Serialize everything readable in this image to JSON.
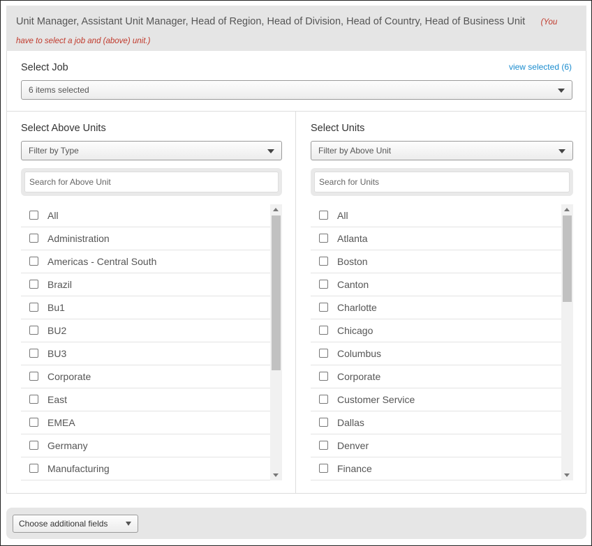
{
  "header": {
    "roles": "Unit Manager, Assistant Unit Manager, Head of Region, Head of Division, Head of Country, Head of Business Unit",
    "warning": "(You have to select a job and (above) unit.)"
  },
  "job": {
    "label": "Select Job",
    "view_selected": "view selected (6)",
    "dropdown_value": "6 items selected"
  },
  "above_units": {
    "label": "Select Above Units",
    "filter": "Filter by Type",
    "search_placeholder": "Search for Above Unit",
    "items": [
      "All",
      "Administration",
      "Americas - Central South",
      "Brazil",
      "Bu1",
      "BU2",
      "BU3",
      "Corporate",
      "East",
      "EMEA",
      "Germany",
      "Manufacturing"
    ]
  },
  "units": {
    "label": "Select Units",
    "filter": "Filter by Above Unit",
    "search_placeholder": "Search for Units",
    "items": [
      "All",
      "Atlanta",
      "Boston",
      "Canton",
      "Charlotte",
      "Chicago",
      "Columbus",
      "Corporate",
      "Customer Service",
      "Dallas",
      "Denver",
      "Finance"
    ]
  },
  "footer": {
    "additional_fields": "Choose additional fields"
  }
}
